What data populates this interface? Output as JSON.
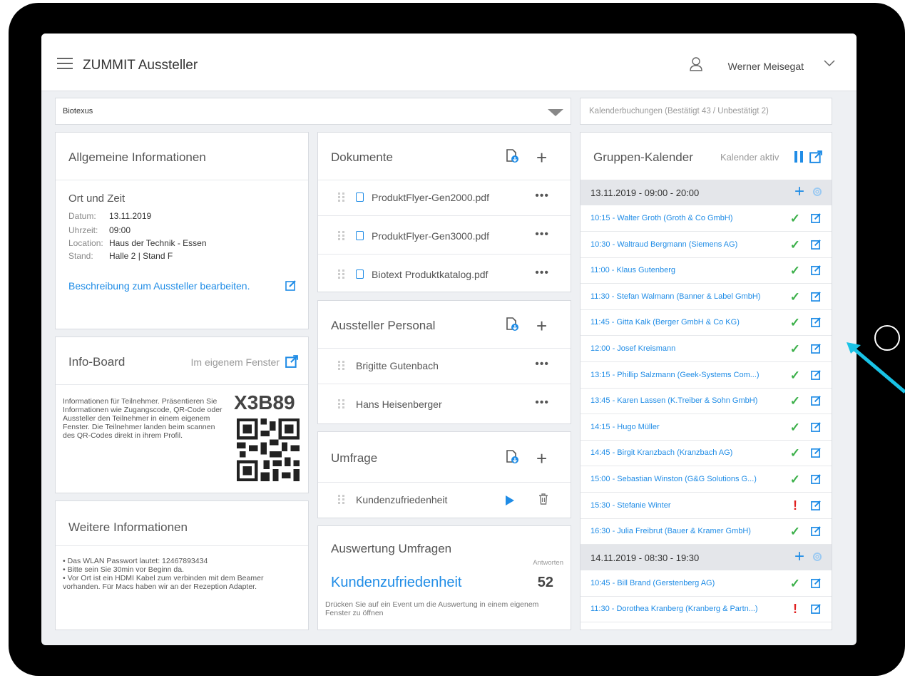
{
  "app": {
    "title": "ZUMMIT Aussteller",
    "user": "Werner Meisegat"
  },
  "company_select": {
    "value": "Biotexus"
  },
  "calendar_bookings": "Kalenderbuchungen (Bestätigt 43 / Unbestätigt 2)",
  "general_info": {
    "title": "Allgemeine Informationen",
    "section": "Ort und Zeit",
    "fields": [
      {
        "label": "Datum:",
        "value": "13.11.2019"
      },
      {
        "label": "Uhrzeit:",
        "value": "09:00"
      },
      {
        "label": "Location:",
        "value": "Haus der Technik - Essen"
      },
      {
        "label": "Stand:",
        "value": "Halle 2  |  Stand F"
      }
    ],
    "edit_link": "Beschreibung zum Aussteller bearbeiten."
  },
  "info_board": {
    "title": "Info-Board",
    "window_link": "Im eigenem Fenster",
    "text": "Informationen für Teilnehmer. Präsentieren Sie Informationen wie Zugangscode, QR-Code oder Aussteller den Teilnehmer in einem eigenem Fenster. Die Teilnehmer landen beim scannen des QR-Codes direkt in ihrem Profil.",
    "code": "X3B89"
  },
  "further_info": {
    "title": "Weitere Informationen",
    "items": [
      "• Das WLAN Passwort lautet: 12467893434",
      "• Bitte sein Sie 30min vor Beginn da.",
      "• Vor Ort ist ein HDMI Kabel zum verbinden mit dem Beamer vorhanden. Für Macs haben wir an der Rezeption Adapter."
    ]
  },
  "documents": {
    "title": "Dokumente",
    "items": [
      "ProduktFlyer-Gen2000.pdf",
      "ProduktFlyer-Gen3000.pdf",
      "Biotext Produktkatalog.pdf"
    ]
  },
  "staff": {
    "title": "Aussteller Personal",
    "items": [
      "Brigitte Gutenbach",
      "Hans Heisenberger"
    ]
  },
  "survey": {
    "title": "Umfrage",
    "items": [
      "Kundenzufriedenheit"
    ]
  },
  "evaluation": {
    "title": "Auswertung Umfragen",
    "answers_label": "Antworten",
    "survey_name": "Kundenzufriedenheit",
    "count": "52",
    "hint": "Drücken Sie auf ein Event um die Auswertung in einem eigenem Fenster zu öffnen"
  },
  "group_calendar": {
    "title": "Gruppen-Kalender",
    "status": "Kalender aktiv",
    "days": [
      {
        "header": "13.11.2019 - 09:00 - 20:00",
        "entries": [
          {
            "text": "10:15 - Walter Groth (Groth & Co GmbH)",
            "status": "ok"
          },
          {
            "text": "10:30 - Waltraud Bergmann (Siemens AG)",
            "status": "ok"
          },
          {
            "text": "11:00 - Klaus Gutenberg",
            "status": "ok"
          },
          {
            "text": "11:30 - Stefan Walmann (Banner & Label GmbH)",
            "status": "ok"
          },
          {
            "text": "11:45 - Gitta Kalk (Berger GmbH & Co KG)",
            "status": "ok"
          },
          {
            "text": "12:00 - Josef Kreismann",
            "status": "ok"
          },
          {
            "text": "13:15 - Phillip Salzmann (Geek-Systems Com...)",
            "status": "ok"
          },
          {
            "text": "13:45 - Karen Lassen (K.Treiber & Sohn GmbH)",
            "status": "ok"
          },
          {
            "text": "14:15 - Hugo Müller",
            "status": "ok"
          },
          {
            "text": "14:45 - Birgit Kranzbach (Kranzbach AG)",
            "status": "ok"
          },
          {
            "text": "15:00 - Sebastian Winston (G&G Solutions G...)",
            "status": "ok"
          },
          {
            "text": "15:30 - Stefanie Winter",
            "status": "warn"
          },
          {
            "text": "16:30 - Julia Freibrut (Bauer & Kramer GmbH)",
            "status": "ok"
          }
        ]
      },
      {
        "header": "14.11.2019 - 08:30 - 19:30",
        "entries": [
          {
            "text": "10:45 - Bill Brand (Gerstenberg AG)",
            "status": "ok"
          },
          {
            "text": "11:30 - Dorothea Kranberg (Kranberg & Partn...)",
            "status": "warn"
          }
        ]
      }
    ]
  },
  "colors": {
    "accent": "#1f8ce6",
    "ok": "#3cb04a",
    "warn": "#e02020"
  }
}
